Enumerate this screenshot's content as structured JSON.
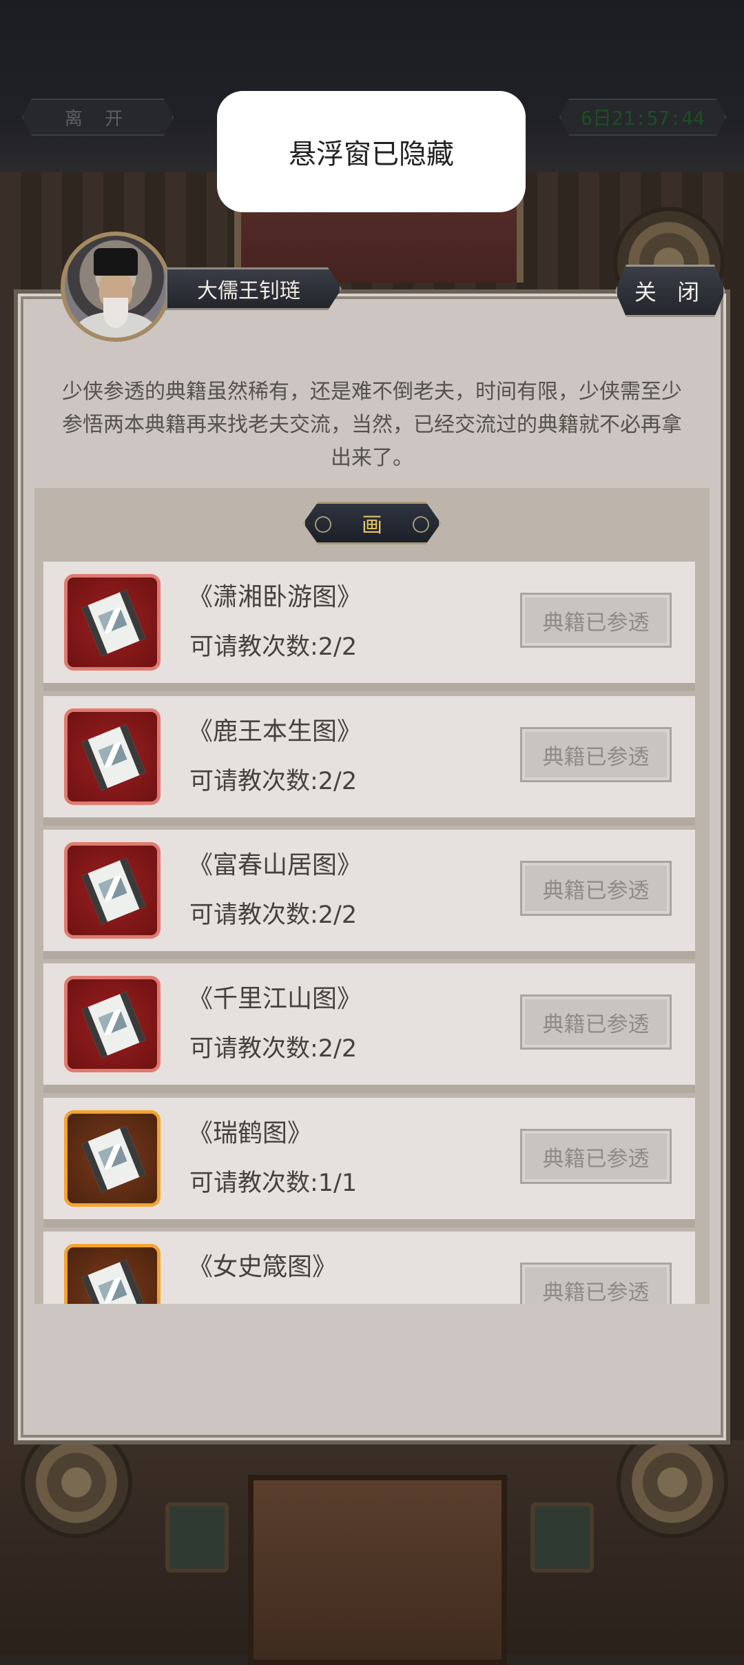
{
  "hud": {
    "leave_label": "离 开",
    "timer": "6日21:57:44"
  },
  "toast": {
    "text": "悬浮窗已隐藏"
  },
  "npc": {
    "name": "大儒王钊琏",
    "avatar_icon": "scholar-portrait"
  },
  "close_label": "关 闭",
  "dialog": {
    "text": "少侠参透的典籍虽然稀有，还是难不倒老夫，时间有限，少侠需至少参悟两本典籍再来找老夫交流，当然，已经交流过的典籍就不必再拿出来了。"
  },
  "category": {
    "label": "画"
  },
  "books": [
    {
      "title": "《潇湘卧游图》",
      "count": "可请教次数:2/2",
      "button": "典籍已参透",
      "icon": "scroll-icon",
      "rarity_color": "#e07a70"
    },
    {
      "title": "《鹿王本生图》",
      "count": "可请教次数:2/2",
      "button": "典籍已参透",
      "icon": "scroll-icon",
      "rarity_color": "#e07a70"
    },
    {
      "title": "《富春山居图》",
      "count": "可请教次数:2/2",
      "button": "典籍已参透",
      "icon": "scroll-icon",
      "rarity_color": "#e07a70"
    },
    {
      "title": "《千里江山图》",
      "count": "可请教次数:2/2",
      "button": "典籍已参透",
      "icon": "scroll-icon",
      "rarity_color": "#e07a70"
    },
    {
      "title": "《瑞鹤图》",
      "count": "可请教次数:1/1",
      "button": "典籍已参透",
      "icon": "scroll-icon",
      "rarity_color": "#f3a431"
    },
    {
      "title": "《女史箴图》",
      "count": "",
      "button": "典籍已参透",
      "icon": "scroll-icon",
      "rarity_color": "#f3a431"
    }
  ]
}
